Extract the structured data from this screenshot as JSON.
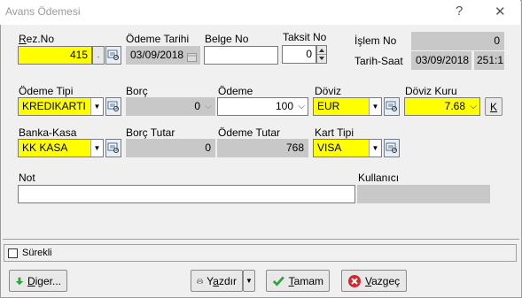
{
  "window": {
    "title": "Avans Ödemesi",
    "help_glyph": "?",
    "close_glyph": "✕"
  },
  "fields": {
    "rez_no": {
      "label_u": "R",
      "label_rest": "ez.No",
      "value": "415",
      "dot": "."
    },
    "odeme_tarihi": {
      "label": "Ödeme Tarihi",
      "value": "03/09/2018"
    },
    "belge_no": {
      "label": "Belge No",
      "value": ""
    },
    "taksit_no": {
      "label": "Taksit No",
      "value": "0"
    },
    "islem_no": {
      "label": "İşlem No",
      "value": "0"
    },
    "tarih_saat": {
      "label": "Tarih-Saat",
      "date": "03/09/2018",
      "time": "251:1"
    },
    "odeme_tipi": {
      "label": "Ödeme Tipi",
      "value": "KREDIKARTI"
    },
    "borc": {
      "label": "Borç",
      "value": "0"
    },
    "odeme": {
      "label": "Ödeme",
      "value": "100"
    },
    "doviz": {
      "label": "Döviz",
      "value": "EUR"
    },
    "doviz_kuru": {
      "label": "Döviz Kuru",
      "value": "7.68",
      "k_button": "K"
    },
    "banka_kasa": {
      "label": "Banka-Kasa",
      "value": "KK KASA"
    },
    "borc_tutar": {
      "label": "Borç Tutar",
      "value": "0"
    },
    "odeme_tutar": {
      "label": "Ödeme Tutar",
      "value": "768"
    },
    "kart_tipi": {
      "label": "Kart Tipi",
      "value": "VISA"
    },
    "not": {
      "label": "Not",
      "value": ""
    },
    "kullanici": {
      "label": "Kullanıcı",
      "value": ""
    }
  },
  "surekli": {
    "label": "Sürekli",
    "checked": false
  },
  "buttons": {
    "diger": {
      "u": "D",
      "rest": "iger..."
    },
    "yazdir": {
      "pre": "Y",
      "u": "a",
      "rest": "zdır"
    },
    "tamam": {
      "u": "T",
      "rest": "amam"
    },
    "vazgec": {
      "u": "V",
      "rest": "azgeç"
    }
  },
  "colors": {
    "highlight": "#ffff00",
    "readonly": "#c8c8c8",
    "ok_green": "#2fa33a",
    "cancel_red": "#d9262c"
  },
  "icons": [
    "lookup-icon",
    "dropdown-arrow-icon",
    "calendar-icon",
    "down-arrow-icon",
    "printer-icon",
    "check-icon",
    "cancel-icon"
  ]
}
